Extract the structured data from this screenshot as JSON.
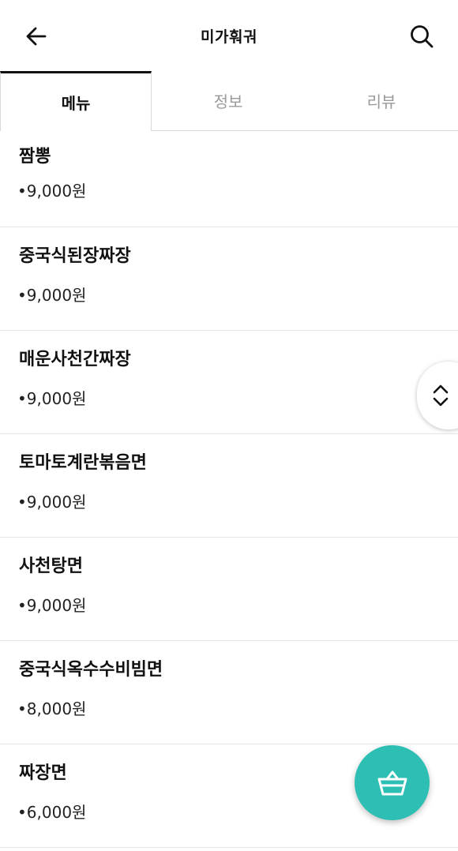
{
  "header": {
    "title": "미가훠궈",
    "back_icon": "arrow-left-icon",
    "search_icon": "search-icon"
  },
  "tabs": [
    {
      "label": "메뉴",
      "active": true
    },
    {
      "label": "정보",
      "active": false
    },
    {
      "label": "리뷰",
      "active": false
    }
  ],
  "menu": [
    {
      "name": "짬뽕",
      "price": "•9,000원"
    },
    {
      "name": "중국식된장짜장",
      "price": "•9,000원"
    },
    {
      "name": "매운사천간짜장",
      "price": "•9,000원"
    },
    {
      "name": "토마토계란볶음면",
      "price": "•9,000원"
    },
    {
      "name": "사천탕면",
      "price": "•9,000원"
    },
    {
      "name": "중국식옥수수비빔면",
      "price": "•8,000원"
    },
    {
      "name": "짜장면",
      "price": "•6,000원"
    }
  ],
  "floating": {
    "scroll_icon": "chevron-up-down-icon",
    "cart_icon": "basket-icon",
    "cart_color": "#2ebfb4"
  }
}
